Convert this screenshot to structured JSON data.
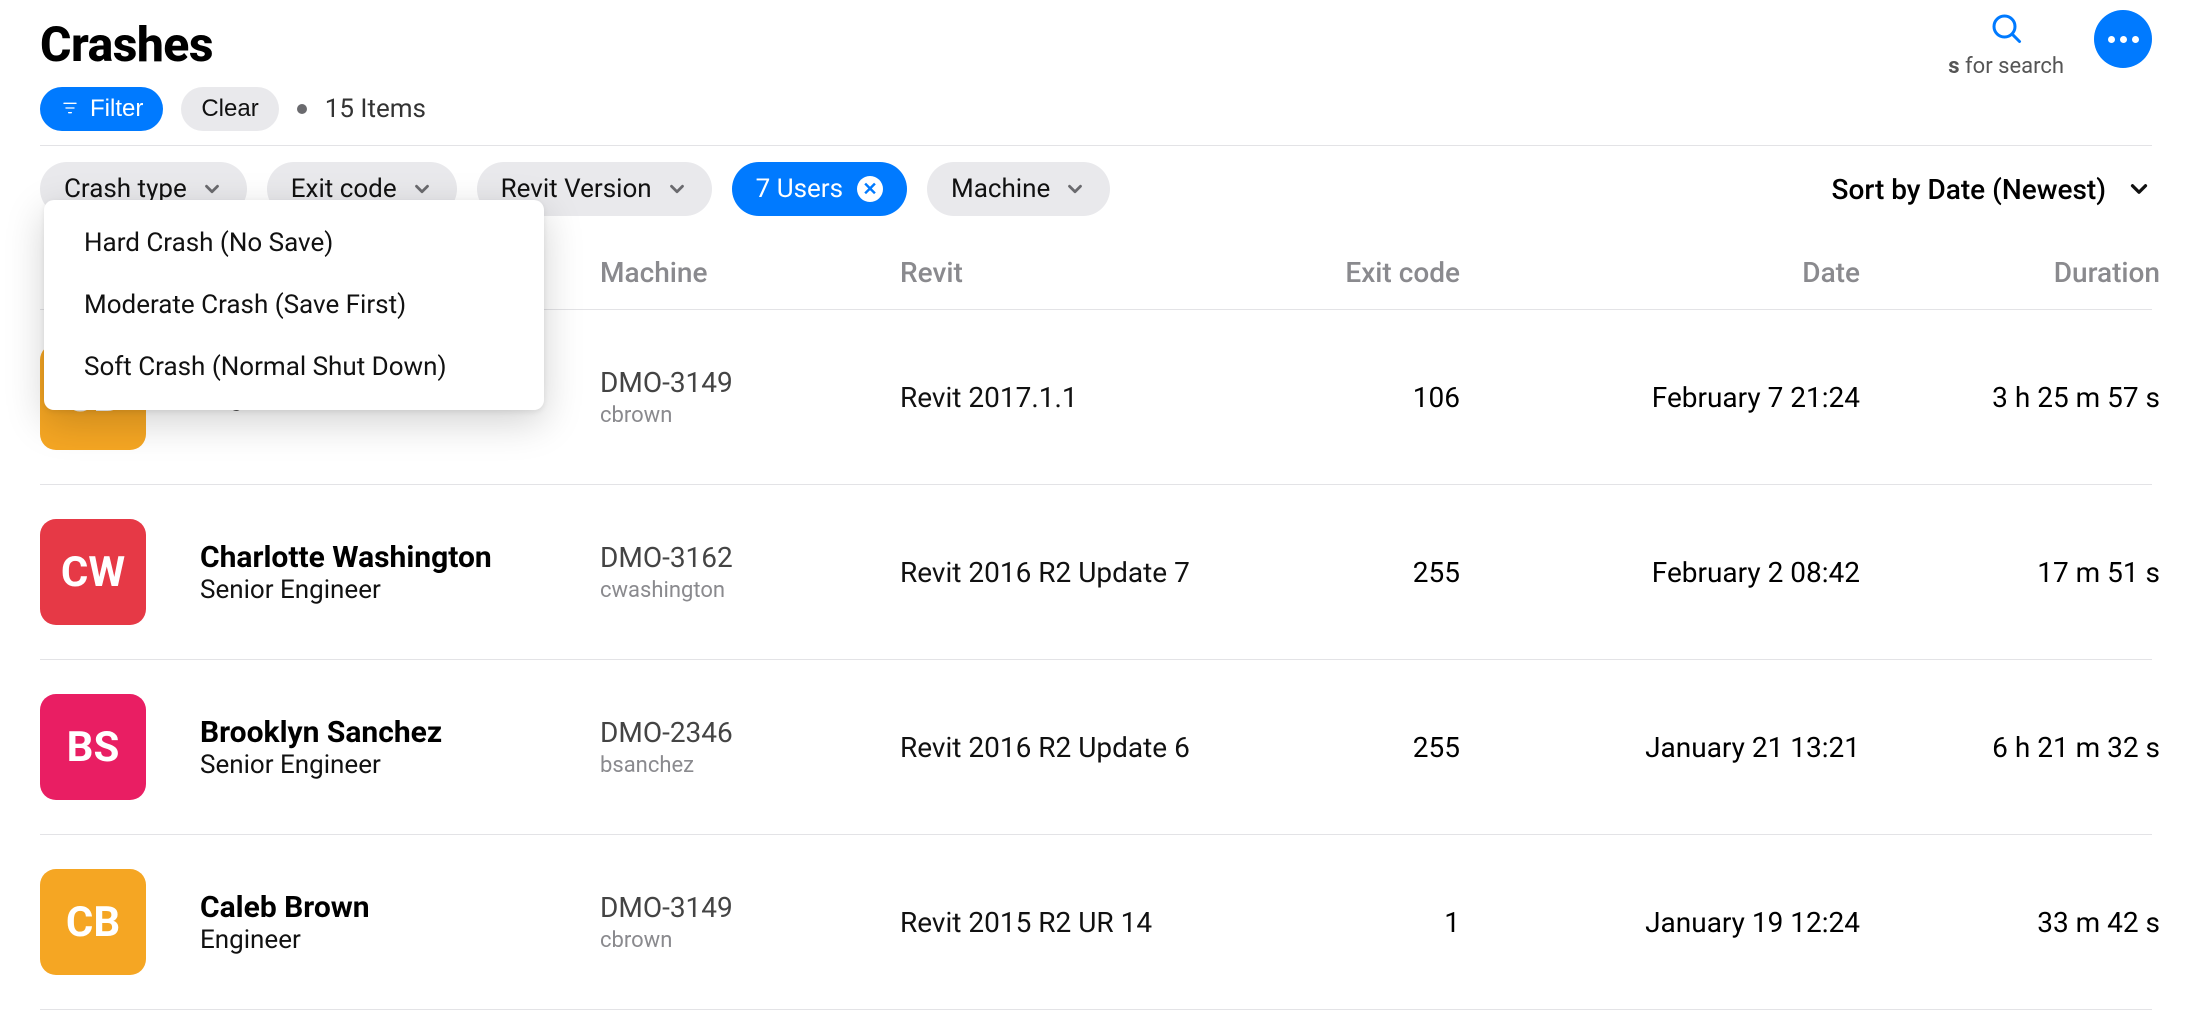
{
  "header": {
    "title": "Crashes",
    "filter_label": "Filter",
    "clear_label": "Clear",
    "items_label": "15 Items",
    "search_hint_bold": "s",
    "search_hint_rest": " for search"
  },
  "chips": {
    "crash_type": "Crash type",
    "exit_code": "Exit code",
    "revit_version": "Revit Version",
    "users": "7 Users",
    "machine": "Machine"
  },
  "sort_label": "Sort by Date (Newest)",
  "dropdown": {
    "items": [
      "Hard Crash (No Save)",
      "Moderate Crash (Save First)",
      "Soft Crash (Normal Shut Down)"
    ]
  },
  "columns": {
    "user": "",
    "name": "",
    "machine": "Machine",
    "revit": "Revit",
    "exit": "Exit code",
    "date": "Date",
    "duration": "Duration"
  },
  "rows": [
    {
      "initials": "CB",
      "color": "#f5a623",
      "name": "",
      "role": "Engineer",
      "machine": "DMO-3149",
      "machine_user": "cbrown",
      "revit": "Revit 2017.1.1",
      "exit": "106",
      "date": "February 7 21:24",
      "duration": "3 h 25 m 57 s"
    },
    {
      "initials": "CW",
      "color": "#e63946",
      "name": "Charlotte Washington",
      "role": "Senior Engineer",
      "machine": "DMO-3162",
      "machine_user": "cwashington",
      "revit": "Revit 2016 R2 Update 7",
      "exit": "255",
      "date": "February 2 08:42",
      "duration": "17 m 51 s"
    },
    {
      "initials": "BS",
      "color": "#e91e63",
      "name": "Brooklyn Sanchez",
      "role": "Senior Engineer",
      "machine": "DMO-2346",
      "machine_user": "bsanchez",
      "revit": "Revit 2016 R2 Update 6",
      "exit": "255",
      "date": "January 21 13:21",
      "duration": "6 h 21 m 32 s"
    },
    {
      "initials": "CB",
      "color": "#f5a623",
      "name": "Caleb Brown",
      "role": "Engineer",
      "machine": "DMO-3149",
      "machine_user": "cbrown",
      "revit": "Revit 2015 R2 UR 14",
      "exit": "1",
      "date": "January 19 12:24",
      "duration": "33 m 42 s"
    }
  ]
}
